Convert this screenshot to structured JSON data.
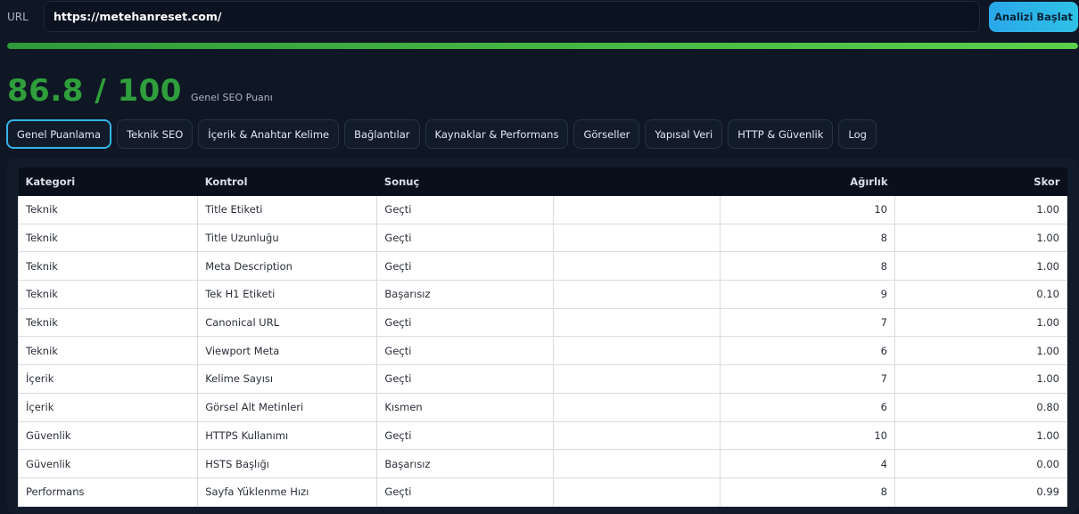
{
  "topbar": {
    "url_label": "URL",
    "url_value": "https://metehanreset.com/",
    "start_button": "Analizi Başlat"
  },
  "progress": {
    "percent": 100,
    "color": "#4cc048"
  },
  "score": {
    "value": "86.8 / 100",
    "label": "Genel SEO Puanı",
    "color": "#2f9e3b"
  },
  "tabs": [
    {
      "label": "Genel Puanlama",
      "active": true
    },
    {
      "label": "Teknik SEO",
      "active": false
    },
    {
      "label": "İçerik & Anahtar Kelime",
      "active": false
    },
    {
      "label": "Bağlantılar",
      "active": false
    },
    {
      "label": "Kaynaklar & Performans",
      "active": false
    },
    {
      "label": "Görseller",
      "active": false
    },
    {
      "label": "Yapısal Veri",
      "active": false
    },
    {
      "label": "HTTP & Güvenlik",
      "active": false
    },
    {
      "label": "Log",
      "active": false
    }
  ],
  "table": {
    "headers": [
      "Kategori",
      "Kontrol",
      "Sonuç",
      "",
      "Ağırlık",
      "Skor"
    ],
    "rows": [
      [
        "Teknik",
        "Title Etiketi",
        "Geçti",
        "10",
        "1.00"
      ],
      [
        "Teknik",
        "Title Uzunluğu",
        "Geçti",
        "8",
        "1.00"
      ],
      [
        "Teknik",
        "Meta Description",
        "Geçti",
        "8",
        "1.00"
      ],
      [
        "Teknik",
        "Tek H1 Etiketi",
        "Başarısız",
        "9",
        "0.10"
      ],
      [
        "Teknik",
        "Canonical URL",
        "Geçti",
        "7",
        "1.00"
      ],
      [
        "Teknik",
        "Viewport Meta",
        "Geçti",
        "6",
        "1.00"
      ],
      [
        "İçerik",
        "Kelime Sayısı",
        "Geçti",
        "7",
        "1.00"
      ],
      [
        "İçerik",
        "Görsel Alt Metinleri",
        "Kısmen",
        "6",
        "0.80"
      ],
      [
        "Güvenlik",
        "HTTPS Kullanımı",
        "Geçti",
        "10",
        "1.00"
      ],
      [
        "Güvenlik",
        "HSTS Başlığı",
        "Başarısız",
        "4",
        "0.00"
      ],
      [
        "Performans",
        "Sayfa Yüklenme Hızı",
        "Geçti",
        "8",
        "0.99"
      ]
    ]
  }
}
